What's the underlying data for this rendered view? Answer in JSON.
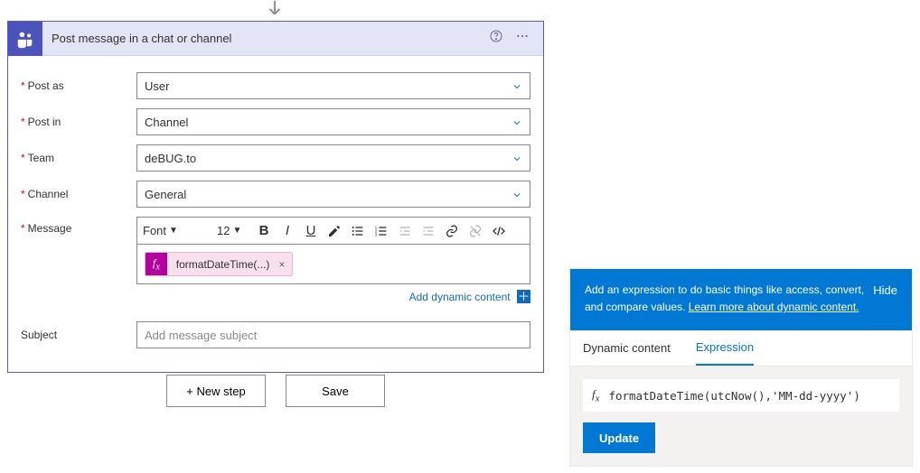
{
  "card": {
    "title": "Post message in a chat or channel",
    "fields": {
      "post_as": {
        "label": "Post as",
        "value": "User"
      },
      "post_in": {
        "label": "Post in",
        "value": "Channel"
      },
      "team": {
        "label": "Team",
        "value": "deBUG.to"
      },
      "channel": {
        "label": "Channel",
        "value": "General"
      },
      "message": {
        "label": "Message"
      },
      "subject": {
        "label": "Subject",
        "placeholder": "Add message subject"
      }
    },
    "toolbar": {
      "font": "Font",
      "size": "12"
    },
    "pill": {
      "text": "formatDateTime(...)"
    },
    "dynamic_link": "Add dynamic content"
  },
  "actions": {
    "new_step": "+ New step",
    "save": "Save"
  },
  "panel": {
    "tip_text": "Add an expression to do basic things like access, convert, and compare values. ",
    "tip_link": "Learn more about dynamic content.",
    "hide": "Hide",
    "tabs": {
      "dynamic": "Dynamic content",
      "expression": "Expression"
    },
    "expr": "formatDateTime(utcNow(),'MM-dd-yyyy')",
    "update": "Update"
  }
}
